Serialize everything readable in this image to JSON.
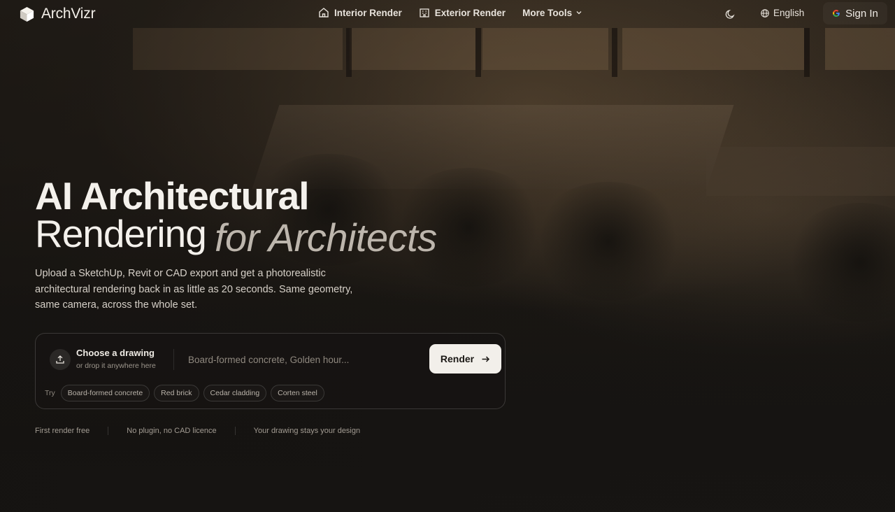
{
  "brand": {
    "name": "ArchVizr"
  },
  "nav": {
    "items": [
      {
        "label": "Interior Render",
        "icon": "home-icon"
      },
      {
        "label": "Exterior Render",
        "icon": "building-icon"
      },
      {
        "label": "More Tools",
        "icon": "chevron-down-icon"
      }
    ]
  },
  "header": {
    "theme_icon": "moon-icon",
    "language": "English",
    "sign_in": "Sign In"
  },
  "hero": {
    "title_line1": "AI Architectural",
    "title_line2": "Rendering",
    "title_accent": "for Architects",
    "lead": "Upload a SketchUp, Revit or CAD export and get a photorealistic architectural rendering back in as little as 20 seconds. Same geometry, same camera, across the whole set."
  },
  "upload": {
    "title": "Choose a drawing",
    "subtitle": "or drop it anywhere here",
    "prompt_placeholder": "Board-formed concrete, Golden hour...",
    "prompt_value": "",
    "render_label": "Render",
    "try_label": "Try",
    "suggestions": [
      "Board-formed concrete",
      "Red brick",
      "Cedar cladding",
      "Corten steel"
    ]
  },
  "trust": [
    "First render free",
    "No plugin, no CAD licence",
    "Your drawing stays your design"
  ],
  "colors": {
    "background": "#17140f",
    "button_bg": "#f2efea",
    "accent_text": "#bdb6ad"
  }
}
